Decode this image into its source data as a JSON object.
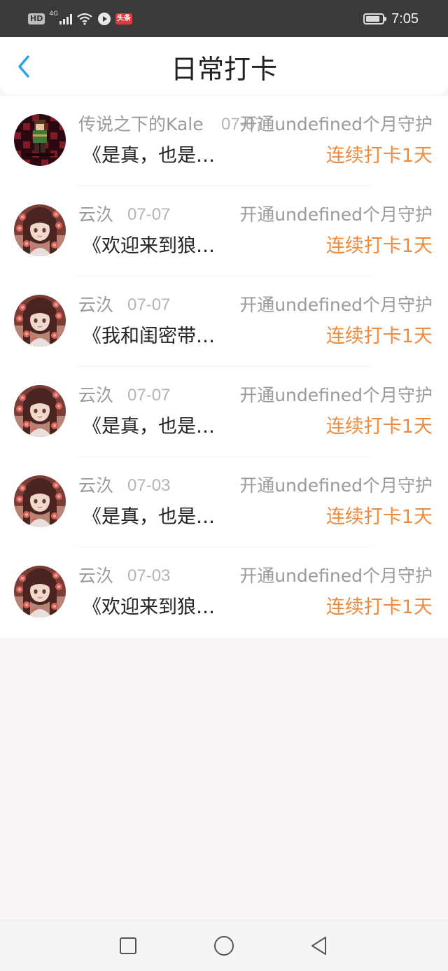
{
  "status_bar": {
    "hd_label": "HD",
    "network_label": "4G",
    "news_app_label": "头条",
    "time": "7:05"
  },
  "header": {
    "title": "日常打卡",
    "back_icon": "chevron-left-icon",
    "accent_color": "#2aa3e8"
  },
  "checkins": [
    {
      "user": "传说之下的Kale",
      "date": "07-07",
      "guard": "开通undefined个月守护",
      "title": "《是真，也是…",
      "streak": "连续打卡1天",
      "avatar": "pixel-character-avatar"
    },
    {
      "user": "云汣",
      "date": "07-07",
      "guard": "开通undefined个月守护",
      "title": "《欢迎来到狼…",
      "streak": "连续打卡1天",
      "avatar": "anime-girl-avatar"
    },
    {
      "user": "云汣",
      "date": "07-07",
      "guard": "开通undefined个月守护",
      "title": "《我和闺密带…",
      "streak": "连续打卡1天",
      "avatar": "anime-girl-avatar"
    },
    {
      "user": "云汣",
      "date": "07-07",
      "guard": "开通undefined个月守护",
      "title": "《是真，也是…",
      "streak": "连续打卡1天",
      "avatar": "anime-girl-avatar"
    },
    {
      "user": "云汣",
      "date": "07-03",
      "guard": "开通undefined个月守护",
      "title": "《是真，也是…",
      "streak": "连续打卡1天",
      "avatar": "anime-girl-avatar"
    },
    {
      "user": "云汣",
      "date": "07-03",
      "guard": "开通undefined个月守护",
      "title": "《欢迎来到狼…",
      "streak": "连续打卡1天",
      "avatar": "anime-girl-avatar"
    }
  ],
  "colors": {
    "streak": "#f08a3c",
    "meta_text": "#9a9a9a",
    "title_text": "#222222",
    "page_background": "#f8f6f7"
  },
  "nav_bar": {
    "icons": [
      "recent-apps-icon",
      "home-icon",
      "back-triangle-icon"
    ]
  }
}
